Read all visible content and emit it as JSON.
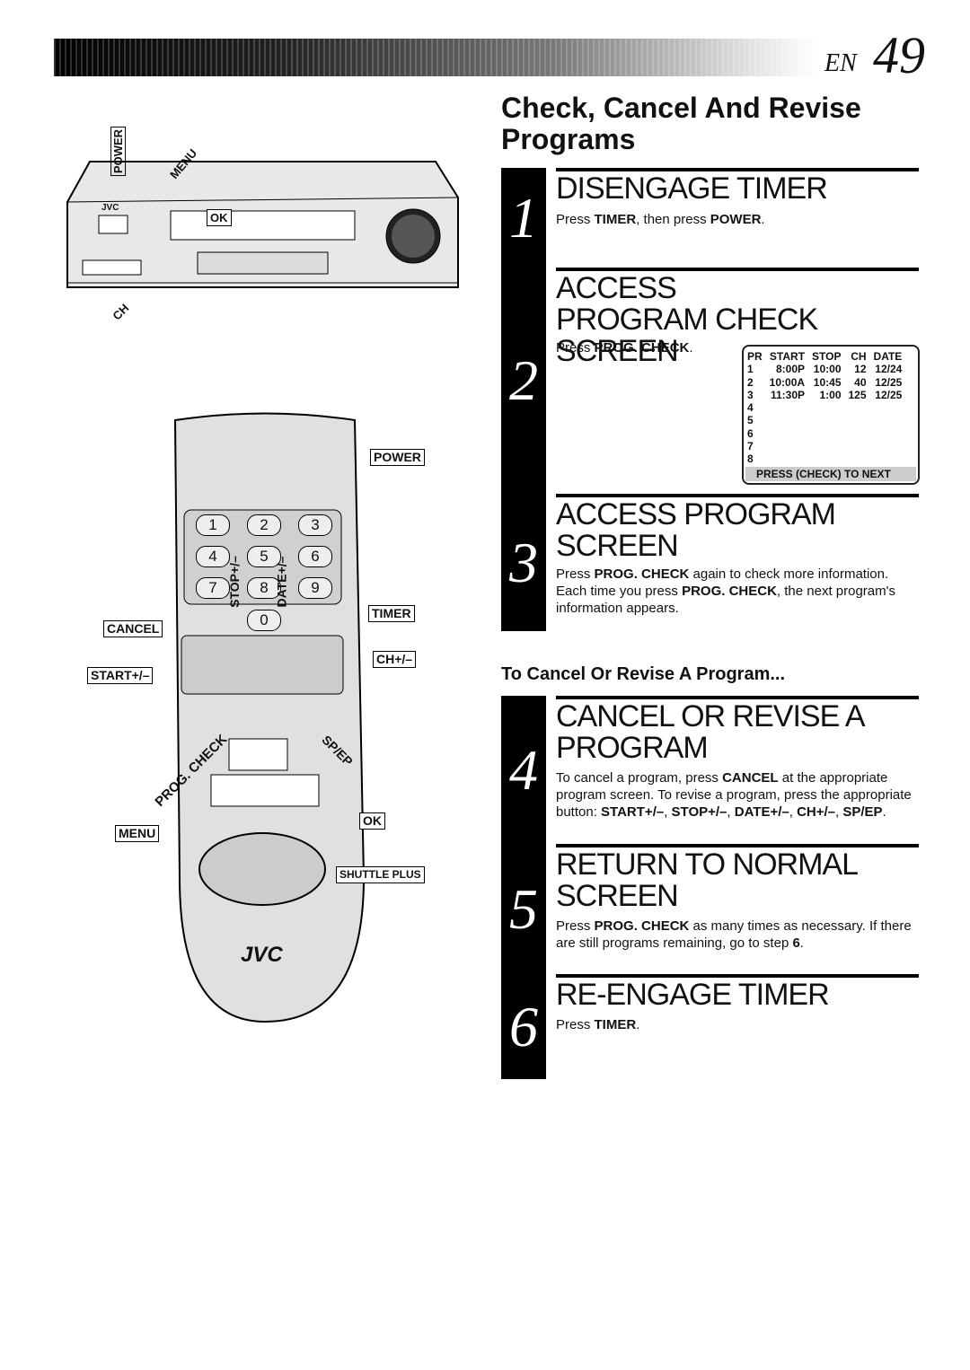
{
  "header": {
    "lang": "EN",
    "page": "49"
  },
  "title": "Check, Cancel And Revise Programs",
  "subheading": "To Cancel Or Revise A Program...",
  "steps": [
    {
      "n": "1",
      "heading": "DISENGAGE TIMER",
      "body": [
        {
          "t": "Press "
        },
        {
          "t": "TIMER",
          "b": true
        },
        {
          "t": ", then press "
        },
        {
          "t": "POWER",
          "b": true
        },
        {
          "t": "."
        }
      ]
    },
    {
      "n": "2",
      "heading": "ACCESS PROGRAM CHECK SCREEN",
      "body": [
        {
          "t": "Press "
        },
        {
          "t": "PROG. CHECK",
          "b": true
        },
        {
          "t": "."
        }
      ]
    },
    {
      "n": "3",
      "heading": "ACCESS PROGRAM SCREEN",
      "body": [
        {
          "t": "Press "
        },
        {
          "t": "PROG. CHECK",
          "b": true
        },
        {
          "t": " again to check more information. Each time you press "
        },
        {
          "t": "PROG. CHECK",
          "b": true
        },
        {
          "t": ", the next program's information appears."
        }
      ]
    },
    {
      "n": "4",
      "heading": "CANCEL OR REVISE A PROGRAM",
      "body": [
        {
          "t": "To cancel a program, press "
        },
        {
          "t": "CANCEL",
          "b": true
        },
        {
          "t": " at the appropriate program screen. To revise a program, press the appropriate button: "
        },
        {
          "t": "START+/–",
          "b": true
        },
        {
          "t": ", "
        },
        {
          "t": "STOP+/–",
          "b": true
        },
        {
          "t": ", "
        },
        {
          "t": "DATE+/–",
          "b": true
        },
        {
          "t": ", "
        },
        {
          "t": "CH+/–",
          "b": true
        },
        {
          "t": ", "
        },
        {
          "t": "SP/EP",
          "b": true
        },
        {
          "t": "."
        }
      ]
    },
    {
      "n": "5",
      "heading": "RETURN TO NORMAL SCREEN",
      "body": [
        {
          "t": "Press "
        },
        {
          "t": "PROG. CHECK",
          "b": true
        },
        {
          "t": " as many times as necessary. If there are still programs remaining, go to step "
        },
        {
          "t": "6",
          "b": true
        },
        {
          "t": "."
        }
      ]
    },
    {
      "n": "6",
      "heading": "RE-ENGAGE TIMER",
      "body": [
        {
          "t": "Press "
        },
        {
          "t": "TIMER",
          "b": true
        },
        {
          "t": "."
        }
      ]
    }
  ],
  "program_table": {
    "headers": [
      "PR",
      "START",
      "STOP",
      "CH",
      "DATE"
    ],
    "rows": [
      [
        "1",
        "8:00P",
        "10:00",
        "12",
        "12/24"
      ],
      [
        "2",
        "10:00A",
        "10:45",
        "40",
        "12/25"
      ],
      [
        "3",
        "11:30P",
        "1:00",
        "125",
        "12/25"
      ],
      [
        "4",
        "",
        "",
        "",
        ""
      ],
      [
        "5",
        "",
        "",
        "",
        ""
      ],
      [
        "6",
        "",
        "",
        "",
        ""
      ],
      [
        "7",
        "",
        "",
        "",
        ""
      ],
      [
        "8",
        "",
        "",
        "",
        ""
      ]
    ],
    "footer": "PRESS (CHECK) TO NEXT"
  },
  "vcr_labels": {
    "power": "POWER",
    "menu": "MENU",
    "ok": "OK",
    "ch": "CH",
    "brand": "JVC"
  },
  "remote_labels": {
    "power": "POWER",
    "timer": "TIMER",
    "cancel": "CANCEL",
    "ch": "CH+/–",
    "start": "START+/–",
    "stop": "STOP+/–",
    "date": "DATE+/–",
    "prog_check": "PROG. CHECK",
    "spep": "SP/EP",
    "ok": "OK",
    "menu": "MENU",
    "shuttle": "SHUTTLE PLUS",
    "brand": "JVC",
    "keys": [
      "1",
      "2",
      "3",
      "4",
      "5",
      "6",
      "7",
      "8",
      "9",
      "0"
    ]
  }
}
